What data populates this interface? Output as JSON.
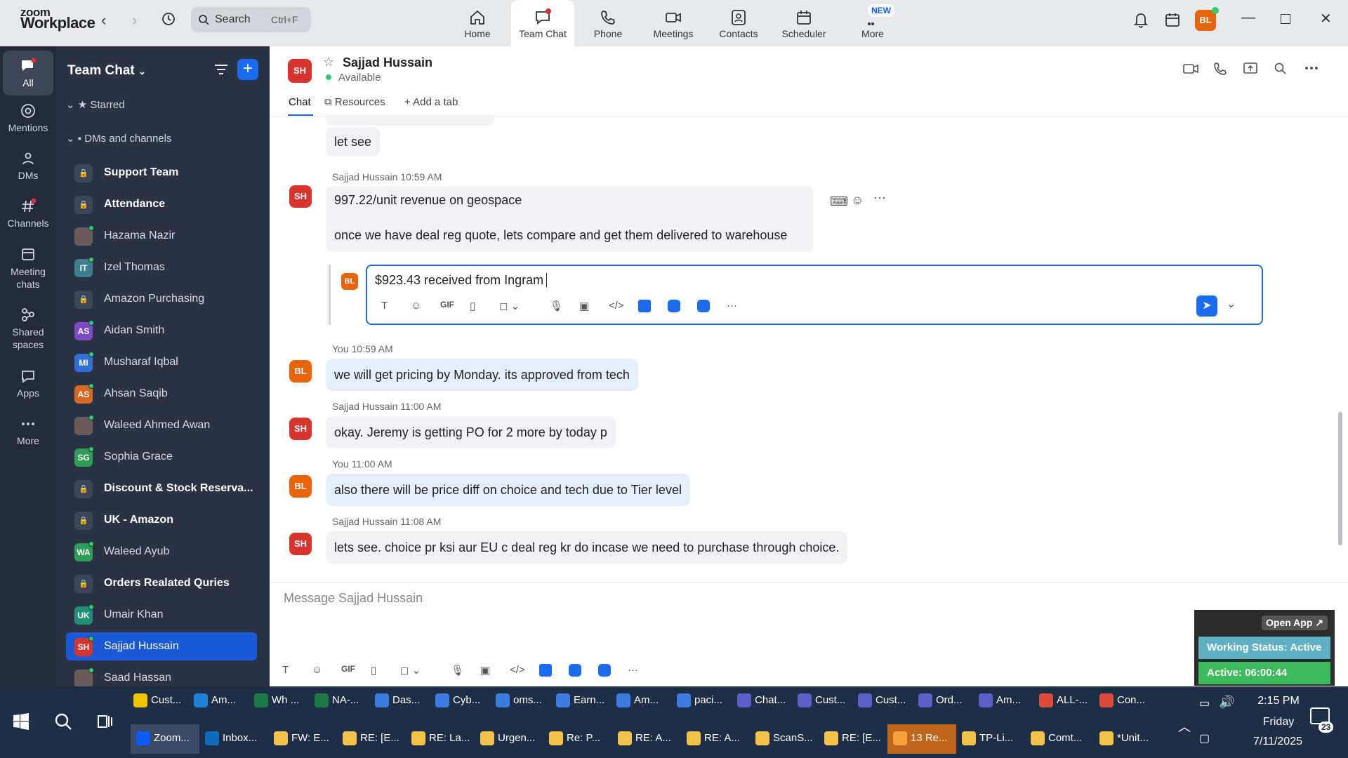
{
  "app": {
    "brand_top": "zoom",
    "brand_bottom": "Workplace"
  },
  "search": {
    "placeholder": "Search",
    "shortcut": "Ctrl+F"
  },
  "topnav": [
    {
      "label": "Home",
      "icon": "home-icon"
    },
    {
      "label": "Team Chat",
      "icon": "chat-icon"
    },
    {
      "label": "Phone",
      "icon": "phone-icon"
    },
    {
      "label": "Meetings",
      "icon": "video-icon"
    },
    {
      "label": "Contacts",
      "icon": "contacts-icon"
    },
    {
      "label": "Scheduler",
      "icon": "calendar-icon"
    },
    {
      "label": "More",
      "icon": "more-icon"
    }
  ],
  "new_badge": "NEW",
  "user_initials": "BL",
  "rail": [
    {
      "label": "All"
    },
    {
      "label": "Mentions"
    },
    {
      "label": "DMs"
    },
    {
      "label": "Channels"
    },
    {
      "label": "Meeting chats"
    },
    {
      "label": "Shared spaces"
    },
    {
      "label": "Apps"
    },
    {
      "label": "More"
    }
  ],
  "sidebar": {
    "title": "Team Chat",
    "sections": {
      "starred": "Starred",
      "dms": "DMs and channels"
    },
    "items": [
      {
        "name": "Support Team",
        "initials": "",
        "bold": true,
        "type": "lock"
      },
      {
        "name": "Attendance",
        "initials": "",
        "bold": true,
        "type": "lock"
      },
      {
        "name": "Hazama Nazir",
        "initials": "",
        "bold": false,
        "type": "photo"
      },
      {
        "name": "Izel Thomas",
        "initials": "IT",
        "bold": false,
        "type": "avatar",
        "color": "#3d7f8c"
      },
      {
        "name": "Amazon Purchasing",
        "initials": "",
        "bold": false,
        "type": "lock"
      },
      {
        "name": "Aidan Smith",
        "initials": "AS",
        "bold": false,
        "type": "avatar",
        "color": "#7d4bc4"
      },
      {
        "name": "Musharaf Iqbal",
        "initials": "MI",
        "bold": false,
        "type": "avatar",
        "color": "#2f6fd6"
      },
      {
        "name": "Ahsan Saqib",
        "initials": "AS",
        "bold": false,
        "type": "avatar",
        "color": "#d9691f"
      },
      {
        "name": "Waleed Ahmed Awan",
        "initials": "",
        "bold": false,
        "type": "photo"
      },
      {
        "name": "Sophia Grace",
        "initials": "SG",
        "bold": false,
        "type": "avatar",
        "color": "#2e9e56"
      },
      {
        "name": "Discount & Stock Reserva...",
        "initials": "",
        "bold": true,
        "type": "lock"
      },
      {
        "name": "UK - Amazon",
        "initials": "",
        "bold": true,
        "type": "lock"
      },
      {
        "name": "Waleed Ayub",
        "initials": "WA",
        "bold": false,
        "type": "avatar",
        "color": "#2e9e56"
      },
      {
        "name": "Orders Realated Quries",
        "initials": "",
        "bold": true,
        "type": "lock"
      },
      {
        "name": "Umair Khan",
        "initials": "UK",
        "bold": false,
        "type": "avatar",
        "color": "#1f8f77"
      },
      {
        "name": "Sajjad Hussain",
        "initials": "SH",
        "bold": false,
        "type": "avatar",
        "color": "#d6342c",
        "selected": true
      },
      {
        "name": "Saad Hassan",
        "initials": "",
        "bold": false,
        "type": "photo"
      }
    ]
  },
  "chat": {
    "contact_initials": "SH",
    "contact_name": "Sajjad Hussain",
    "contact_status": "Available",
    "tabs": {
      "chat": "Chat",
      "resources": "Resources",
      "add": "Add a tab"
    },
    "messages": [
      {
        "text": "let see"
      },
      {
        "sender": "Sajjad Hussain",
        "time": "10:59 AM",
        "initials": "SH",
        "lines": [
          "997.22/unit revenue on geospace",
          "once we have deal reg quote, lets compare and get them delivered to warehouse"
        ]
      },
      {
        "sender": "You",
        "time": "10:59 AM",
        "initials": "BL",
        "text": "we will get pricing by Monday. its approved from tech"
      },
      {
        "sender": "Sajjad Hussain",
        "time": "11:00 AM",
        "initials": "SH",
        "text": "okay. Jeremy is getting PO for 2 more by today p"
      },
      {
        "sender": "You",
        "time": "11:00 AM",
        "initials": "BL",
        "text": "also there will be price diff on choice and tech due to Tier level"
      },
      {
        "sender": "Sajjad Hussain",
        "time": "11:08 AM",
        "initials": "SH",
        "text": "lets see. choice pr ksi aur EU c deal reg kr do incase we need to purchase through choice."
      }
    ],
    "reply_initials": "BL",
    "reply_text": "$923.43 received from Ingram",
    "composer_placeholder": "Message Sajjad Hussain",
    "gif": "GIF"
  },
  "status_widget": {
    "open_app": "Open App ↗",
    "working": "Working Status: Active",
    "active": "Active: 06:00:44"
  },
  "taskbar": {
    "row1": [
      "Cust...",
      "Am...",
      "Wh ...",
      "NA-...",
      "Das...",
      "Cyb...",
      "oms...",
      "Earn...",
      "Am...",
      "paci...",
      "Chat...",
      "Cust...",
      "Cust...",
      "Ord...",
      "Am...",
      "ALL-...",
      "Con..."
    ],
    "row2": [
      "Zoom...",
      "Inbox...",
      "FW: E...",
      "RE: [E...",
      "RE: La...",
      "Urgen...",
      "Re: P...",
      "RE: A...",
      "RE: A...",
      "ScanS...",
      "RE: [E...",
      "13 Re...",
      "TP-Li...",
      "Comt...",
      "*Unit..."
    ],
    "time": "2:15 PM",
    "day": "Friday",
    "date": "7/11/2025",
    "notif": "23"
  }
}
